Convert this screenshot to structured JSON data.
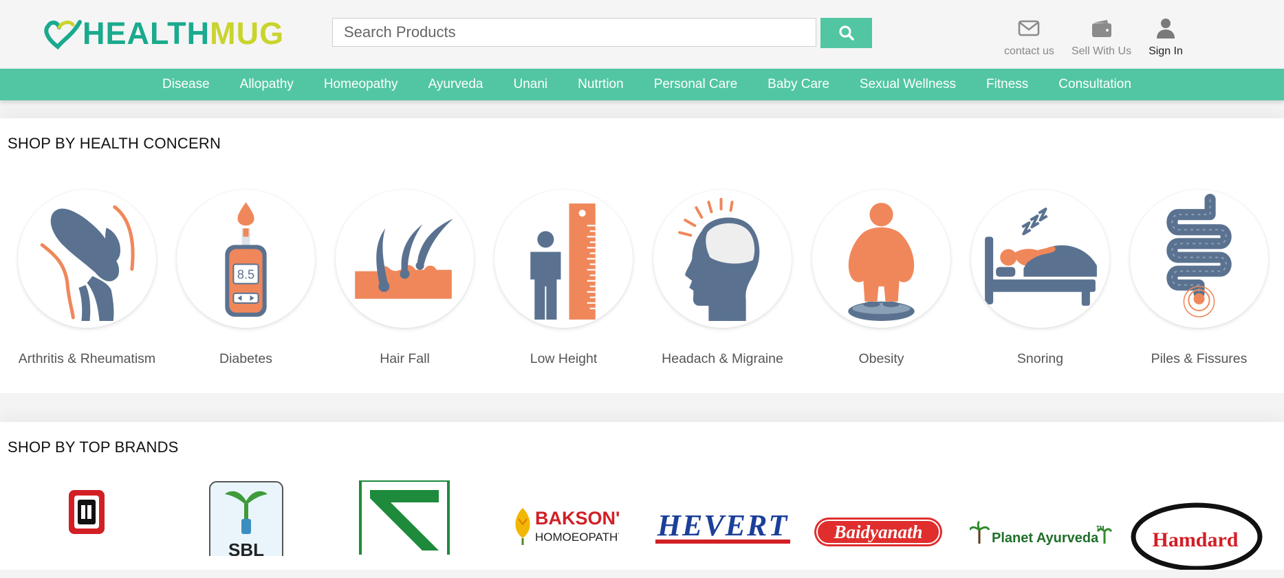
{
  "logo": {
    "part1": "HEALTH",
    "part2": "MUG"
  },
  "search": {
    "placeholder": "Search Products",
    "value": ""
  },
  "top_links": [
    {
      "label": "contact us",
      "icon": "envelope-icon"
    },
    {
      "label": "Sell With Us",
      "icon": "wallet-icon"
    },
    {
      "label": "Sign In",
      "icon": "user-icon"
    }
  ],
  "nav": [
    "Disease",
    "Allopathy",
    "Homeopathy",
    "Ayurveda",
    "Unani",
    "Nutrtion",
    "Personal Care",
    "Baby Care",
    "Sexual Wellness",
    "Fitness",
    "Consultation"
  ],
  "health_section": {
    "title": "SHOP BY HEALTH CONCERN",
    "items": [
      {
        "label": "Arthritis & Rheumatism",
        "icon": "knee-joint-icon"
      },
      {
        "label": "Diabetes",
        "icon": "glucometer-icon"
      },
      {
        "label": "Hair Fall",
        "icon": "hair-follicle-icon"
      },
      {
        "label": "Low Height",
        "icon": "height-ruler-icon"
      },
      {
        "label": "Headach & Migraine",
        "icon": "headache-icon"
      },
      {
        "label": "Obesity",
        "icon": "obesity-scale-icon"
      },
      {
        "label": "Snoring",
        "icon": "snoring-bed-icon"
      },
      {
        "label": "Piles & Fissures",
        "icon": "intestine-icon"
      }
    ]
  },
  "brands_section": {
    "title": "SHOP BY TOP BRANDS",
    "brands": [
      {
        "name": "",
        "logo": "red-box-brand-logo"
      },
      {
        "name": "SBL",
        "logo": "sbl-logo"
      },
      {
        "name": "",
        "logo": "green-s-brand-logo"
      },
      {
        "name": "BAKSON'S",
        "sub": "HOMOEOPATHY",
        "logo": "baksons-logo"
      },
      {
        "name": "HEVERT",
        "logo": "hevert-logo"
      },
      {
        "name": "Baidyanath",
        "logo": "baidyanath-logo"
      },
      {
        "name": "Planet Ayurveda",
        "tm": "TM",
        "logo": "planet-ayurveda-logo"
      },
      {
        "name": "Hamdard",
        "logo": "hamdard-logo"
      }
    ]
  },
  "colors": {
    "accent": "#52c6a2",
    "icon_blue": "#5a7290",
    "icon_orange": "#f0875a",
    "logo_green": "#1aaa8e",
    "logo_yellow": "#c9d42c"
  }
}
